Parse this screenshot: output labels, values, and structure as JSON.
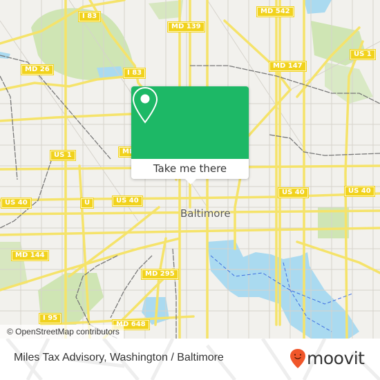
{
  "map": {
    "city_label": "Baltimore",
    "attribution": "© OpenStreetMap contributors",
    "colors": {
      "land": "#f2f1ed",
      "park": "#cfe5b4",
      "water": "#aadaf0",
      "road_major": "#f5e36a",
      "road_minor": "#d6d3cc",
      "rail": "#777777",
      "shield": "#f1d21c"
    },
    "road_shields": [
      {
        "label": "I 83"
      },
      {
        "label": "MD 139"
      },
      {
        "label": "MD 542"
      },
      {
        "label": "US 1"
      },
      {
        "label": "MD 26"
      },
      {
        "label": "I 83"
      },
      {
        "label": "MD 147"
      },
      {
        "label": "US 1"
      },
      {
        "label": "MD"
      },
      {
        "label": "US 40"
      },
      {
        "label": "U"
      },
      {
        "label": "US 40"
      },
      {
        "label": "US 40"
      },
      {
        "label": "US 40"
      },
      {
        "label": "MD 144"
      },
      {
        "label": "MD 295"
      },
      {
        "label": "I 95"
      },
      {
        "label": "MD 648"
      }
    ]
  },
  "popup": {
    "icon": "location-pin-icon",
    "button_label": "Take me there",
    "color": "#1db866"
  },
  "footer": {
    "title": "Miles Tax Advisory, Washington / Baltimore",
    "brand": {
      "name": "moovit",
      "icon": "moovit-pin-icon",
      "color": "#f0562a"
    }
  }
}
